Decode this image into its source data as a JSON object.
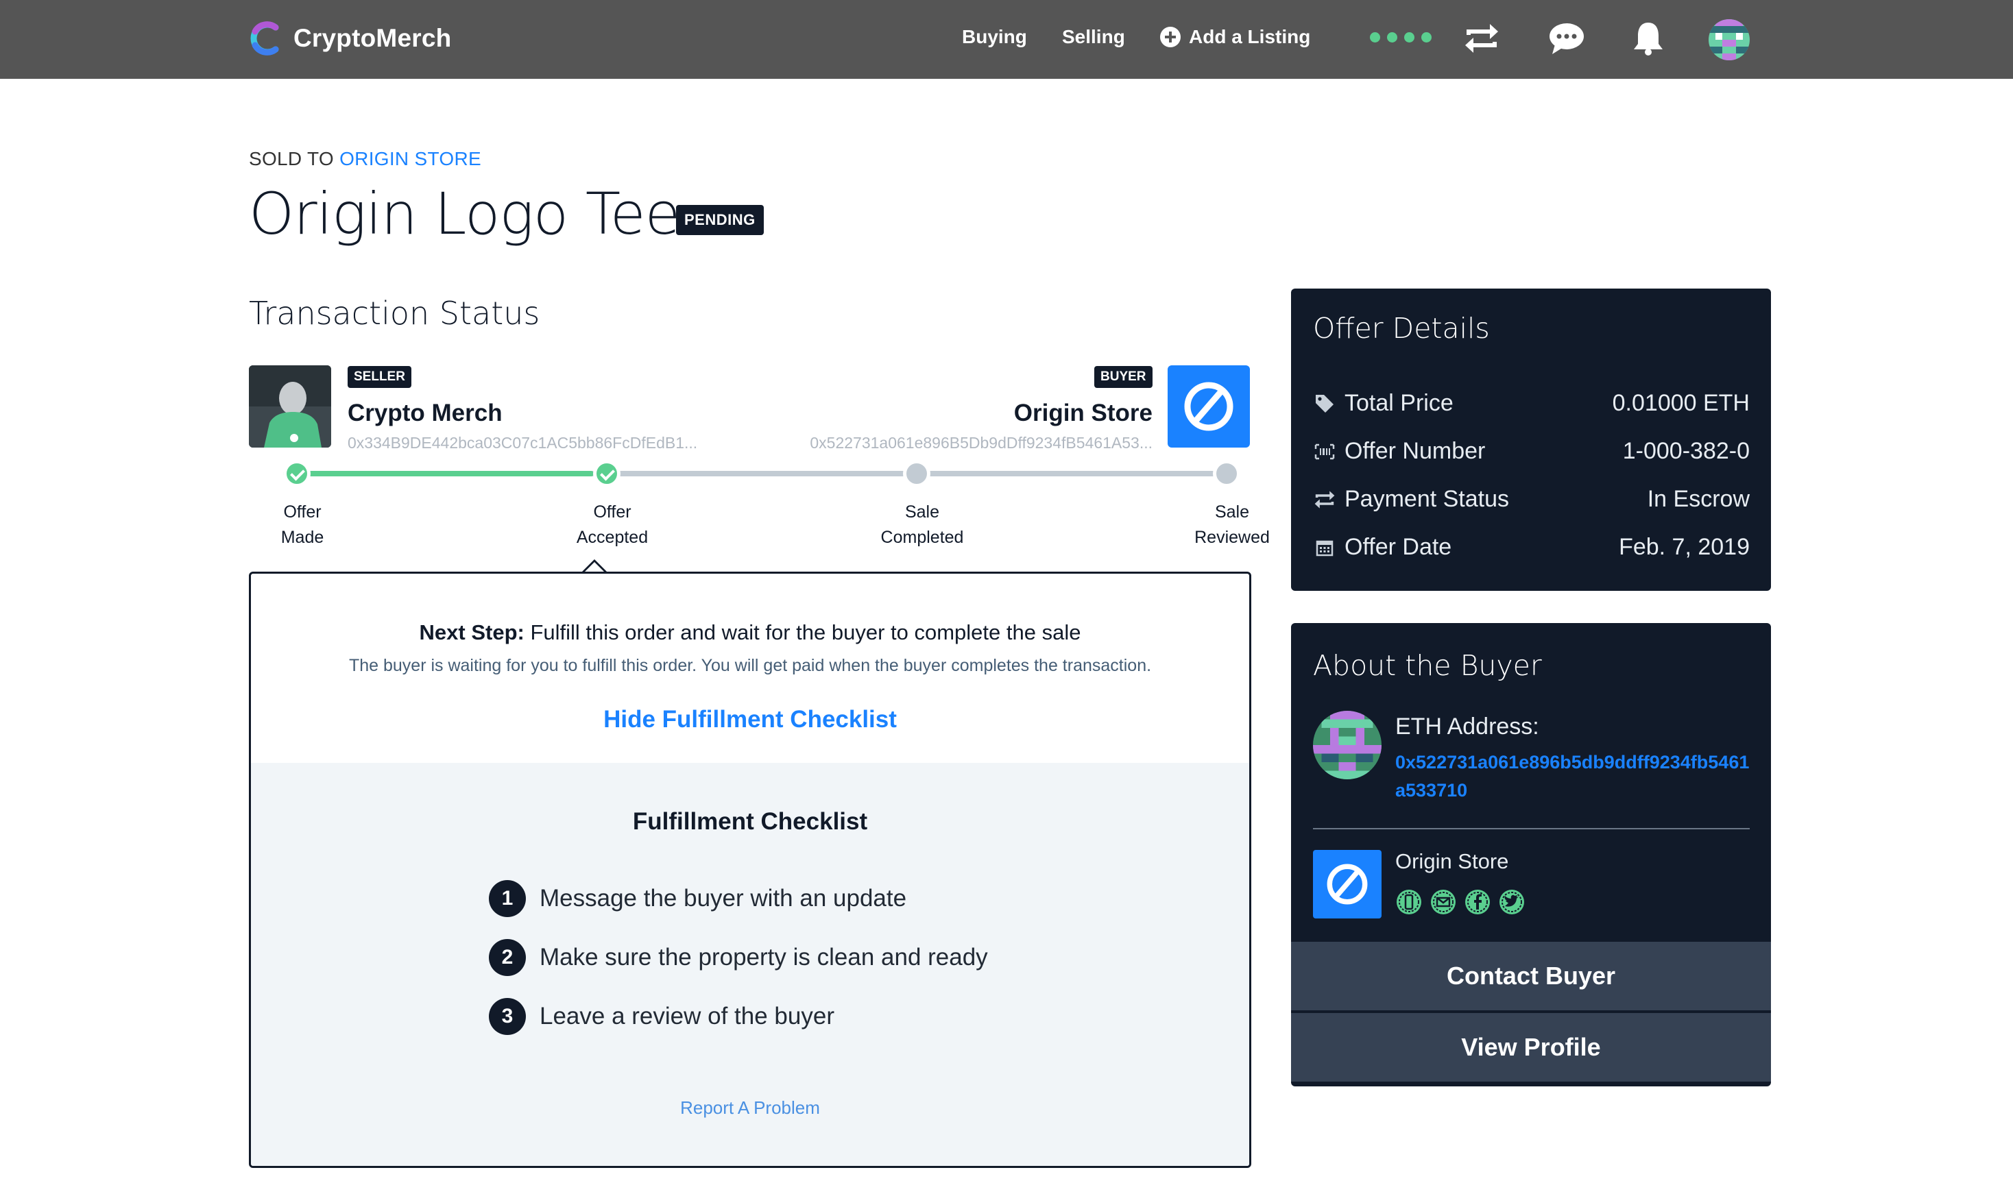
{
  "navbar": {
    "brand": "CryptoMerch",
    "links": {
      "buying": "Buying",
      "selling": "Selling",
      "add_listing": "Add a Listing"
    }
  },
  "header": {
    "sold_to_prefix": "SOLD TO",
    "sold_to_name": "ORIGIN STORE",
    "title": "Origin Logo Tee",
    "status_badge": "PENDING"
  },
  "transaction": {
    "section_title": "Transaction Status",
    "seller": {
      "badge": "SELLER",
      "name": "Crypto Merch",
      "address": "0x334B9DE442bca03C07c1AC5bb86FcDfEdB1..."
    },
    "buyer": {
      "badge": "BUYER",
      "name": "Origin Store",
      "address": "0x522731a061e896B5Db9dDff9234fB5461A53..."
    },
    "progress_fraction": 0.333,
    "steps": [
      {
        "line1": "Offer",
        "line2": "Made",
        "done": true
      },
      {
        "line1": "Offer",
        "line2": "Accepted",
        "done": true
      },
      {
        "line1": "Sale",
        "line2": "Completed",
        "done": false
      },
      {
        "line1": "Sale",
        "line2": "Reviewed",
        "done": false
      }
    ]
  },
  "next_step": {
    "label": "Next Step:",
    "text": "Fulfill this order and wait for the buyer to complete the sale",
    "description": "The buyer is waiting for you to fulfill this order. You will get paid when the buyer completes the transaction.",
    "toggle": "Hide Fulfillment Checklist",
    "checklist_title": "Fulfillment Checklist",
    "checklist": [
      {
        "num": "1",
        "text": "Message the buyer with an update"
      },
      {
        "num": "2",
        "text": "Make sure the property is clean and ready"
      },
      {
        "num": "3",
        "text": "Leave a review of the buyer"
      }
    ],
    "report": "Report A Problem"
  },
  "offer_details": {
    "title": "Offer Details",
    "rows": [
      {
        "label": "Total Price",
        "value": "0.01000 ETH",
        "icon": "tag-icon"
      },
      {
        "label": "Offer Number",
        "value": "1-000-382-0",
        "icon": "barcode-icon"
      },
      {
        "label": "Payment Status",
        "value": "In Escrow",
        "icon": "transfer-icon"
      },
      {
        "label": "Offer Date",
        "value": "Feb. 7, 2019",
        "icon": "calendar-icon"
      }
    ]
  },
  "about_buyer": {
    "title": "About the Buyer",
    "eth_label": "ETH Address:",
    "eth_address": "0x522731a061e896b5db9ddff9234fb5461a533710",
    "store_name": "Origin Store",
    "verifications": [
      "phone-icon",
      "email-icon",
      "facebook-icon",
      "twitter-icon"
    ],
    "contact_button": "Contact Buyer",
    "profile_button": "View Profile"
  },
  "colors": {
    "navbar": "#555555",
    "accent": "#1a82ff",
    "success": "#5acf8f",
    "dark": "#111a29",
    "button": "#364254"
  }
}
